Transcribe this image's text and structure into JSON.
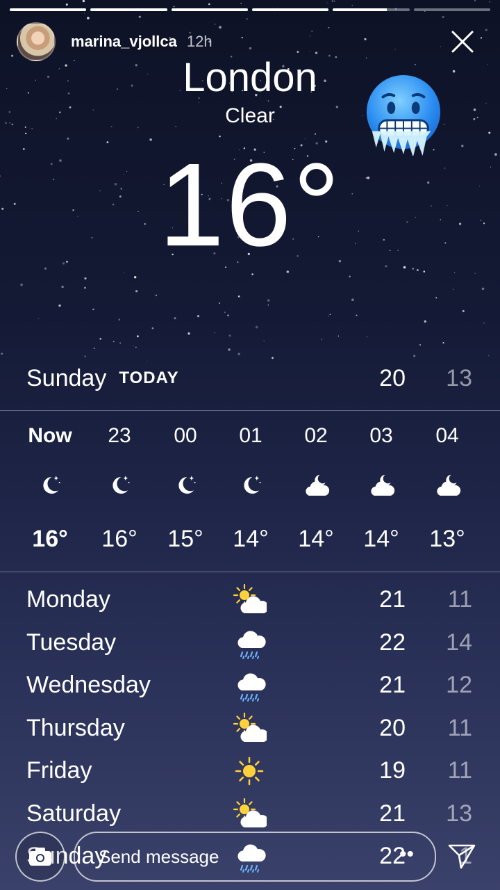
{
  "story": {
    "progress": [
      1,
      1,
      1,
      1,
      0.7,
      0
    ],
    "username": "marina_vjollca",
    "time_ago": "12h"
  },
  "weather": {
    "city": "London",
    "condition": "Clear",
    "current_temp": "16°",
    "today": {
      "day": "Sunday",
      "tag": "TODAY",
      "high": "20",
      "low": "13"
    },
    "hourly": [
      {
        "label": "Now",
        "icon": "moon-icon",
        "temp": "16°"
      },
      {
        "label": "23",
        "icon": "moon-icon",
        "temp": "16°"
      },
      {
        "label": "00",
        "icon": "moon-icon",
        "temp": "15°"
      },
      {
        "label": "01",
        "icon": "moon-icon",
        "temp": "14°"
      },
      {
        "label": "02",
        "icon": "partly-cloudy-night-icon",
        "temp": "14°"
      },
      {
        "label": "03",
        "icon": "partly-cloudy-night-icon",
        "temp": "14°"
      },
      {
        "label": "04",
        "icon": "partly-cloudy-night-icon",
        "temp": "13°"
      }
    ],
    "daily": [
      {
        "day": "Monday",
        "icon": "partly-sunny-icon",
        "high": "21",
        "low": "11"
      },
      {
        "day": "Tuesday",
        "icon": "rain-icon",
        "high": "22",
        "low": "14"
      },
      {
        "day": "Wednesday",
        "icon": "rain-icon",
        "high": "21",
        "low": "12"
      },
      {
        "day": "Thursday",
        "icon": "partly-sunny-icon",
        "high": "20",
        "low": "11"
      },
      {
        "day": "Friday",
        "icon": "sun-icon",
        "high": "19",
        "low": "11"
      },
      {
        "day": "Saturday",
        "icon": "partly-sunny-icon",
        "high": "21",
        "low": "13"
      },
      {
        "day": "Sunday",
        "icon": "rain-icon",
        "high": "22",
        "low": "1"
      }
    ]
  },
  "reply": {
    "placeholder": "Send message",
    "dots": "••"
  },
  "colors": {
    "background_top": "#0d1226",
    "background_bottom": "#3a416a",
    "sun": "#ffd23a"
  }
}
